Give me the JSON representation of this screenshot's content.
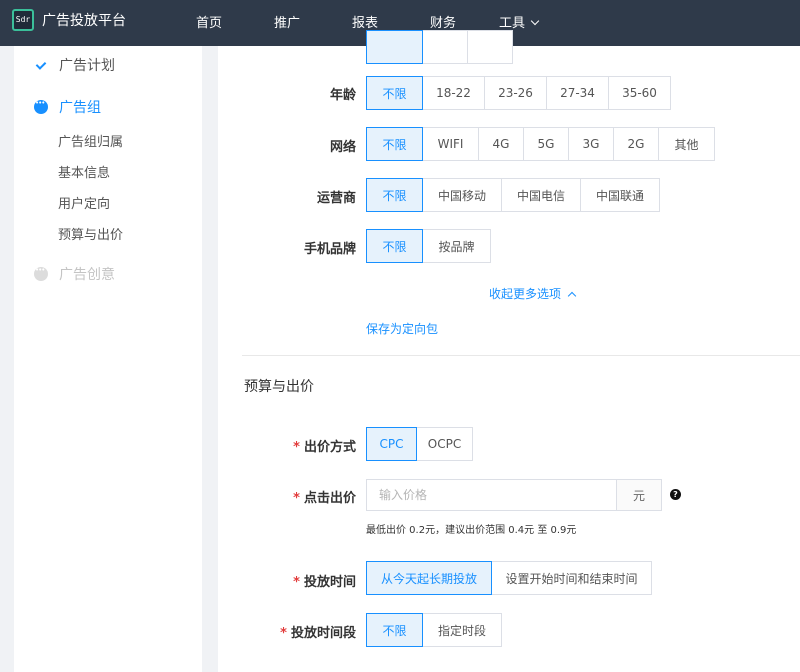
{
  "brand": {
    "logo_text": "Sdr",
    "title": "广告投放平台"
  },
  "nav": {
    "items": [
      "首页",
      "推广",
      "报表",
      "财务",
      "工具"
    ]
  },
  "sidebar": {
    "steps": [
      {
        "label": "广告计划",
        "state": "done"
      },
      {
        "label": "广告组",
        "state": "active"
      },
      {
        "label": "广告创意",
        "state": "pending"
      }
    ],
    "sub_items": [
      "广告组归属",
      "基本信息",
      "用户定向",
      "预算与出价"
    ]
  },
  "targeting": {
    "age": {
      "label": "年龄",
      "options": [
        "不限",
        "18-22",
        "23-26",
        "27-34",
        "35-60"
      ],
      "selected": "不限"
    },
    "network": {
      "label": "网络",
      "options": [
        "不限",
        "WIFI",
        "4G",
        "5G",
        "3G",
        "2G",
        "其他"
      ],
      "selected": "不限"
    },
    "carrier": {
      "label": "运营商",
      "options": [
        "不限",
        "中国移动",
        "中国电信",
        "中国联通"
      ],
      "selected": "不限"
    },
    "phone_brand": {
      "label": "手机品牌",
      "options": [
        "不限",
        "按品牌"
      ],
      "selected": "不限"
    },
    "collapse_link": "收起更多选项",
    "save_link": "保存为定向包"
  },
  "budget": {
    "section_title": "预算与出价",
    "required_mark": "*",
    "bid_method": {
      "label": "出价方式",
      "options": [
        "CPC",
        "OCPC"
      ],
      "selected": "CPC"
    },
    "click_bid": {
      "label": "点击出价",
      "placeholder": "输入价格",
      "unit": "元",
      "help": "?",
      "hint": "最低出价 0.2元，建议出价范围 0.4元 至 0.9元"
    },
    "delivery_time": {
      "label": "投放时间",
      "options": [
        "从今天起长期投放",
        "设置开始时间和结束时间"
      ],
      "selected": "从今天起长期投放"
    },
    "delivery_period": {
      "label": "投放时间段",
      "options": [
        "不限",
        "指定时段"
      ],
      "selected": "不限"
    }
  }
}
